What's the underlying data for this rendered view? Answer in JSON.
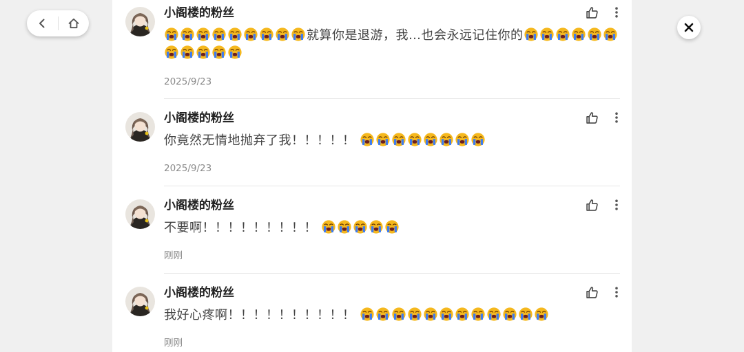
{
  "nav": {
    "back_icon": "chevron-left-icon",
    "home_icon": "home-icon",
    "close_icon": "close-icon"
  },
  "colors": {
    "page_bg": "#f0f0f0",
    "panel_bg": "#ffffff",
    "username": "#222222",
    "body_text": "#444444",
    "meta_text": "#8a8a8a",
    "emoji_face": "#f5b81e",
    "emoji_tear": "#3d7bf0"
  },
  "emoji_name": "loudly-crying-face",
  "comments": [
    {
      "username": "小阁楼的粉丝",
      "pre_emoji_count": 9,
      "text": "就算你是退游，我…也会永远记住你的",
      "post_emoji_count": 11,
      "meta": "2025/9/23"
    },
    {
      "username": "小阁楼的粉丝",
      "pre_emoji_count": 0,
      "text": "你竟然无情地抛弃了我！！！！！",
      "post_emoji_count": 8,
      "meta": "2025/9/23"
    },
    {
      "username": "小阁楼的粉丝",
      "pre_emoji_count": 0,
      "text": "不要啊！！！！！！！！！",
      "post_emoji_count": 5,
      "meta": "刚刚"
    },
    {
      "username": "小阁楼的粉丝",
      "pre_emoji_count": 0,
      "text": "我好心疼啊！！！！！！！！！！",
      "post_emoji_count": 12,
      "meta": "刚刚"
    }
  ]
}
